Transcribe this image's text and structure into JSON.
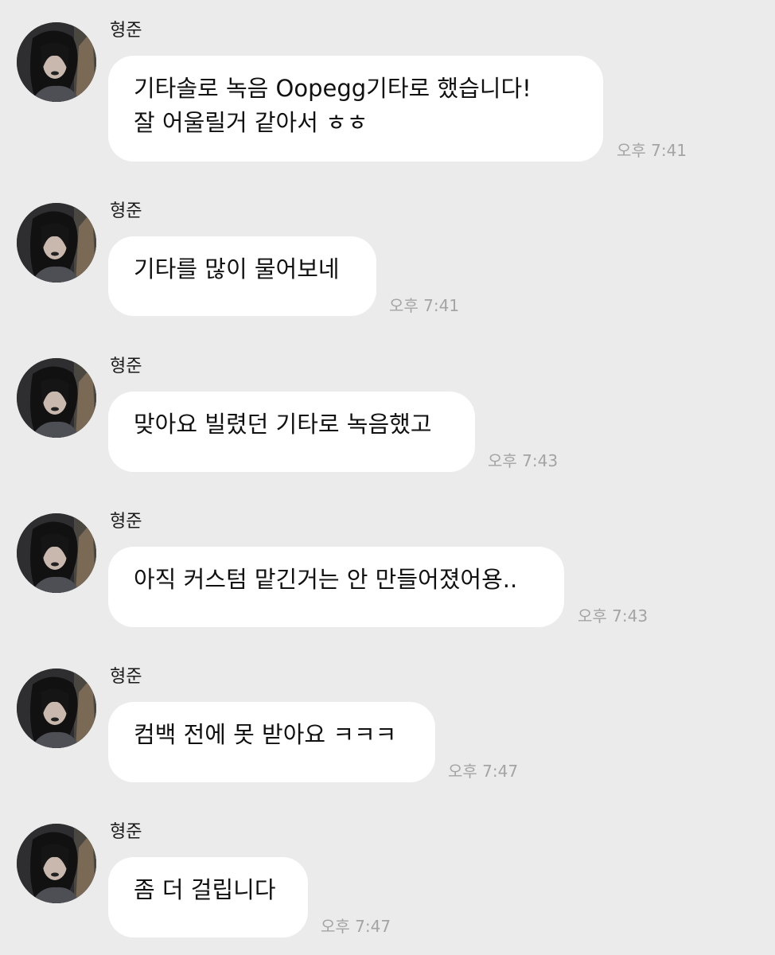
{
  "messages": [
    {
      "sender": "형준",
      "lines": [
        "기타솔로 녹음 Oopegg기타로 했습니다!",
        "잘 어울릴거 같아서 ㅎㅎ"
      ],
      "time": "오후 7:41"
    },
    {
      "sender": "형준",
      "lines": [
        "기타를 많이 물어보네"
      ],
      "time": "오후 7:41"
    },
    {
      "sender": "형준",
      "lines": [
        "맞아요 빌렸던 기타로 녹음했고"
      ],
      "time": "오후 7:43"
    },
    {
      "sender": "형준",
      "lines": [
        "아직 커스텀 맡긴거는 안 만들어졌어용.."
      ],
      "time": "오후 7:43"
    },
    {
      "sender": "형준",
      "lines": [
        "컴백 전에 못 받아요 ㅋㅋㅋ"
      ],
      "time": "오후 7:47"
    },
    {
      "sender": "형준",
      "lines": [
        "좀 더 걸립니다"
      ],
      "time": "오후 7:47"
    }
  ],
  "icons": {
    "avatar": "profile-photo-icon"
  }
}
